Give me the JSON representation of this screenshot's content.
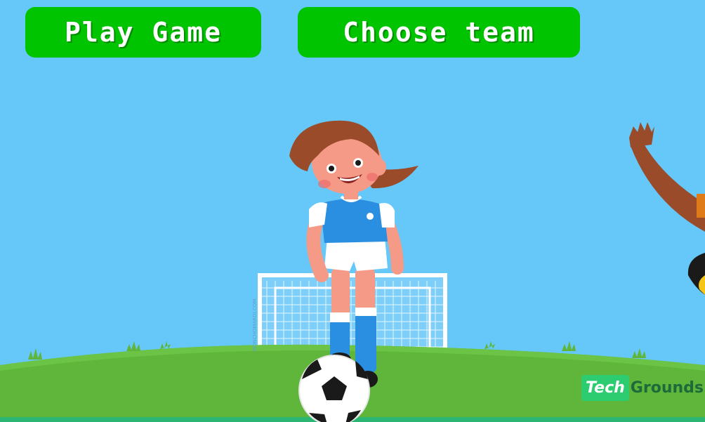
{
  "menu": {
    "play_label": "Play Game",
    "choose_label": "Choose team"
  },
  "watermark": {
    "tech": "Tech",
    "grounds": "Grounds"
  },
  "colors": {
    "sky": "#66c8f8",
    "grass": "#5fb63a",
    "button": "#00c400",
    "jersey": "#2a8fe0"
  }
}
